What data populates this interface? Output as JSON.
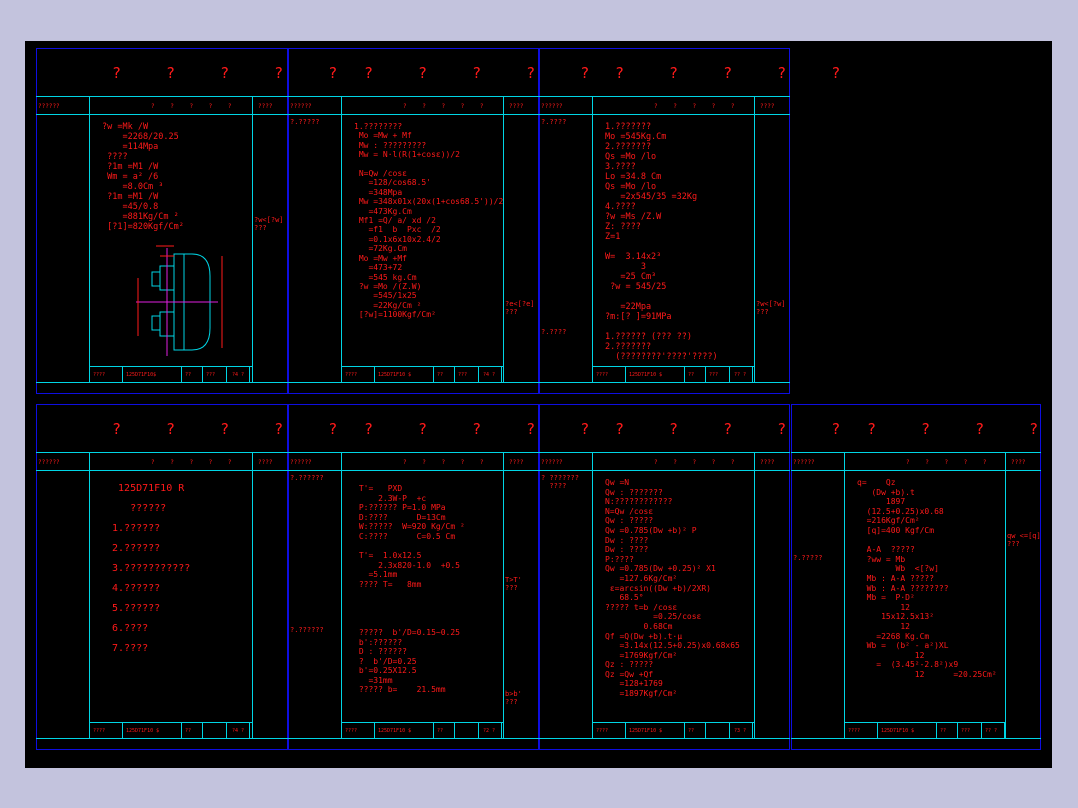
{
  "panels": [
    {
      "title": "? ? ? ? ?",
      "hdr_left": "??????",
      "hdr_mid": "? ? ? ? ?",
      "hdr_right": "????",
      "left_note": "",
      "right_note": "?w<[?w]\n???",
      "foot": [
        "????",
        "125D71F10$",
        "??",
        "???",
        "?4 ?"
      ],
      "body": "?w =Mk /W\n    =2268/20.25\n    =114Mpa\n ????\n ?1m =M1 /W\n Wm = a² /6\n    =8.0Cm ³\n ?1m =M1 /W\n    =45/0.8\n    =881Kg/Cm ²\n [?1]=820Kgf/Cm²"
    },
    {
      "title": "? ? ? ? ?",
      "hdr_left": "??????",
      "hdr_mid": "? ? ? ? ?",
      "hdr_right": "????",
      "left_note": "?.?????",
      "right_note": "?e<[?e]\n???",
      "foot": [
        "????",
        "125D71F10 $",
        "??",
        "???",
        "?4 ?"
      ],
      "body": "1.????????\n Mo =Mw + Mf\n Mw : ?????????\n Mw = N·l(R(1+cosε))/2\n\n N=Qw /cosε\n   =128/cos68.5'\n   =348Mpa\n Mw =348x01x(20x(1+cos68.5'))/2\n   =473Kg.Cm\n Mf1 =Q/ a/ xd /2\n   =f1  b  Pxc  /2\n   =0.1x6x10x2.4/2\n   =72Kg.Cm\n Mo =Mw +Mf\n   =473+72\n   =545 kg.Cm\n ?w =Mo /(Z.W)\n    =545/1x25\n    =22Kg/Cm ²\n [?w]=1100Kgf/Cm²"
    },
    {
      "title": "? ? ? ? ?",
      "hdr_left": "??????",
      "hdr_mid": "? ? ? ? ?",
      "hdr_right": "????",
      "left_note": "?.????",
      "right_note": "?w<[?w]\n???",
      "foot": [
        "????",
        "125D71F10 $",
        "??",
        "???",
        "?? ?"
      ],
      "body": "1.???????\nMo =545Kg.Cm\n2.???????\nQs =Mo /lo\n3.????\nLo =34.8 Cm\nQs =Mo /lo\n   =2x545/35 =32Kg\n4.????\n?w =Ms /Z.W\nZ: ????\nZ=1\n\nW=  3.14x2³\n       3\n   =25 Cm³\n ?w = 545/25\n\n   =22Mpa\n?m:[? ]=91MPa\n\n1.?????? (??? ??)\n2.???????\n  (????????'????'????)",
      "extra_left": "?.????"
    },
    {
      "title": "? ? ? ? ?",
      "hdr_left": "??????",
      "hdr_mid": "? ? ? ? ?",
      "hdr_right": "????",
      "left_note": "",
      "right_note": "",
      "foot": [
        "????",
        "125D71F10 $",
        "??",
        "",
        "?4 ?"
      ],
      "body": "  125D71F10 R\n\n    ??????\n\n 1.??????\n\n 2.??????\n\n 3.???????????\n\n 4.??????\n\n 5.??????\n\n 6.????\n\n 7.????"
    },
    {
      "title": "? ? ? ? ?",
      "hdr_left": "??????",
      "hdr_mid": "? ? ? ? ?",
      "hdr_right": "????",
      "left_note": "?.??????",
      "left_note2": "?.??????",
      "right_note": "T>T'\n???",
      "right_note2": "b>b'\n???",
      "foot": [
        "????",
        "125D71F10 $",
        "??",
        "",
        "?2 ?"
      ],
      "body": " T'=   PXD\n     2.3W-P  +c\n P:?????? P=1.0 MPa\n D:????      D=13Cm\n W:?????  W=920 Kg/Cm ²\n C:????      C=0.5 Cm\n\n T'=  1.0x12.5\n     2.3x820-1.0  +0.5\n   =5.1mm\n ???? T=   8mm\n\n\n\n\n ?????  b'/D=0.15~0.25\n b':??????\n D : ??????\n ?  b'/D=0.25\n b'=0.25X12.5\n   =31mm\n ????? b=    21.5mm"
    },
    {
      "title": "? ? ? ? ?",
      "hdr_left": "??????",
      "hdr_mid": "? ? ? ? ?",
      "hdr_right": "????",
      "left_note": "? ???????\n  ????",
      "right_note": "",
      "foot": [
        "????",
        "125D71F10 $",
        "??",
        "",
        "?3 ?"
      ],
      "body": "Qw =N\nQw : ???????\nN:????????????\nN=Qw /cosε\nQw : ?????\nQw =0.785(Dw +b)² P\nDw : ????\nDw : ????\nP:????\nQw =0.785(Dw +0.25)² X1\n   =127.6Kg/Cm²\n ε=arcsin((Dw +b)/2XR)\n   68.5°\n????? t=b /cosε\n          =0.25/cosε\n        0.68Cm\nQf =Q(Dw +b).t·μ\n   =3.14x(12.5+0.25)x0.68x65\n   =1769Kgf/Cm²\nQz : ?????\nQz =Qw +Qf\n   =128+1769\n   =1897Kgf/Cm²"
    },
    {
      "title": "? ? ? ? ?",
      "hdr_left": "??????",
      "hdr_mid": "? ? ? ? ?",
      "hdr_right": "????",
      "left_note": "?.?????",
      "right_note": "qw <=[q]\n???",
      "foot": [
        "????",
        "125D71F10 $",
        "??",
        "???",
        "?? ?"
      ],
      "body": "q=    Qz\n   (Dw +b).t\n      1897\n  (12.5+0.25)x0.68\n  =216Kgf/Cm²\n  [q]=400 Kgf/Cm\n\n  A-A  ?????\n  ?ww = Mb\n        Wb  <[?w]\n  Mb : A-A ?????\n  Wb : A-A ????????\n  Mb =  P·D²\n         12\n     15x12.5x13²\n         12\n    =2268 Kg.Cm\n  Wb =  (b² - a²)XL\n            12\n    =  (3.45²-2.8²)x9\n            12      =20.25Cm²"
    }
  ]
}
